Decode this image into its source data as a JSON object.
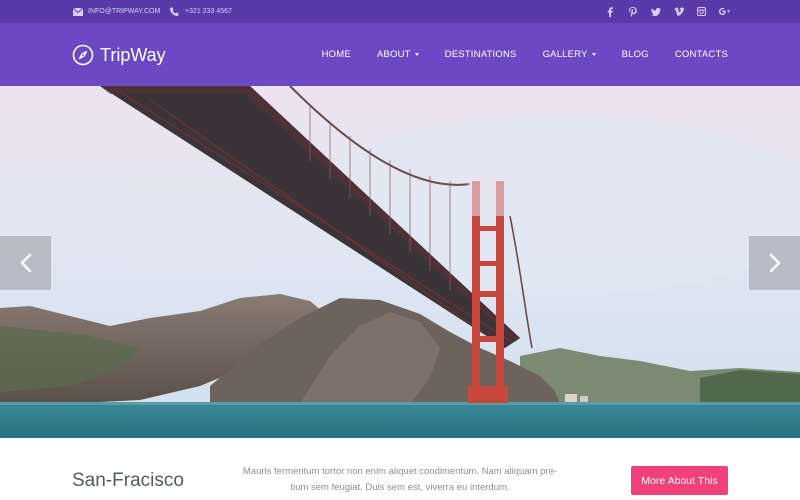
{
  "topbar": {
    "email": "INFO@TRIPWAY.COM",
    "phone": "+321 233 4567",
    "email_icon": "envelope-icon",
    "phone_icon": "phone-icon",
    "socials": [
      {
        "name": "facebook-icon",
        "glyph": "f"
      },
      {
        "name": "pinterest-icon",
        "glyph": "P"
      },
      {
        "name": "twitter-icon",
        "glyph": "t"
      },
      {
        "name": "vimeo-icon",
        "glyph": "v"
      },
      {
        "name": "instagram-icon",
        "glyph": "◻"
      },
      {
        "name": "googleplus-icon",
        "glyph": "g+"
      }
    ]
  },
  "nav": {
    "brand": "TripWay",
    "brand_icon": "compass-icon",
    "items": [
      {
        "label": "HOME",
        "dropdown": false
      },
      {
        "label": "ABOUT",
        "dropdown": true
      },
      {
        "label": "DESTINATIONS",
        "dropdown": false
      },
      {
        "label": "GALLERY",
        "dropdown": true
      },
      {
        "label": "BLOG",
        "dropdown": false
      },
      {
        "label": "CONTACTS",
        "dropdown": false
      }
    ]
  },
  "slider": {
    "prev_icon": "chevron-left-icon",
    "next_icon": "chevron-right-icon"
  },
  "slide": {
    "city": "San-Fracisco",
    "description_line1": "Mauris fermentum tortor non enim aliquet condimentum. Nam aliquam pre-",
    "description_line2": "tium sem feugiat. Duis sem est, viverra eu interdum.",
    "button_label": "More About This"
  },
  "colors": {
    "topbar": "#5a3aa8",
    "navbar": "#6c48c4",
    "accent": "#f0417a"
  }
}
